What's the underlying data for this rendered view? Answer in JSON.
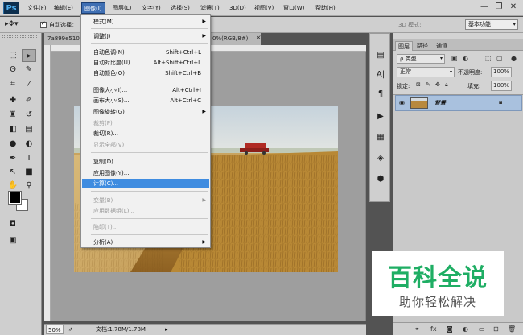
{
  "app": {
    "logo": "Ps"
  },
  "menubar": {
    "items": [
      "文件(F)",
      "编辑(E)",
      "图像(I)",
      "图层(L)",
      "文字(Y)",
      "选择(S)",
      "滤镜(T)",
      "3D(D)",
      "视图(V)",
      "窗口(W)",
      "帮助(H)"
    ],
    "active_index": 2
  },
  "window_controls": {
    "minimize": "—",
    "restore": "❐",
    "close": "✕"
  },
  "options_bar": {
    "tool_icon": "move-tool-icon",
    "auto_select_label": "自动选择：",
    "mode_3d_label": "3D 模式:",
    "workspace": "基本功能"
  },
  "document": {
    "tab_title": "7a899e510f",
    "tab_info": "0%(RGB/8#)",
    "tab_close": "×",
    "zoom": "50%",
    "doc_size": "文档:1.78M/1.78M"
  },
  "image_menu": {
    "items": [
      {
        "label": "模式(M)",
        "shortcut": "",
        "submenu": true,
        "disabled": false
      },
      {
        "label": "调整(J)",
        "shortcut": "",
        "submenu": true,
        "disabled": false
      },
      {
        "label": "自动色调(N)",
        "shortcut": "Shift+Ctrl+L",
        "submenu": false,
        "disabled": false
      },
      {
        "label": "自动对比度(U)",
        "shortcut": "Alt+Shift+Ctrl+L",
        "submenu": false,
        "disabled": false
      },
      {
        "label": "自动颜色(O)",
        "shortcut": "Shift+Ctrl+B",
        "submenu": false,
        "disabled": false
      },
      {
        "label": "图像大小(I)...",
        "shortcut": "Alt+Ctrl+I",
        "submenu": false,
        "disabled": false
      },
      {
        "label": "画布大小(S)...",
        "shortcut": "Alt+Ctrl+C",
        "submenu": false,
        "disabled": false
      },
      {
        "label": "图像旋转(G)",
        "shortcut": "",
        "submenu": true,
        "disabled": false
      },
      {
        "label": "裁剪(P)",
        "shortcut": "",
        "submenu": false,
        "disabled": true
      },
      {
        "label": "裁切(R)...",
        "shortcut": "",
        "submenu": false,
        "disabled": false
      },
      {
        "label": "显示全部(V)",
        "shortcut": "",
        "submenu": false,
        "disabled": true
      },
      {
        "label": "复制(D)...",
        "shortcut": "",
        "submenu": false,
        "disabled": false
      },
      {
        "label": "应用图像(Y)...",
        "shortcut": "",
        "submenu": false,
        "disabled": false
      },
      {
        "label": "计算(C)...",
        "shortcut": "",
        "submenu": false,
        "disabled": false,
        "highlighted": true
      },
      {
        "label": "变量(B)",
        "shortcut": "",
        "submenu": true,
        "disabled": true
      },
      {
        "label": "应用数据组(L)...",
        "shortcut": "",
        "submenu": false,
        "disabled": true
      },
      {
        "label": "陷印(T)...",
        "shortcut": "",
        "submenu": false,
        "disabled": true
      },
      {
        "label": "分析(A)",
        "shortcut": "",
        "submenu": true,
        "disabled": false
      }
    ]
  },
  "layers_panel": {
    "tabs": [
      "图层",
      "路径",
      "通道"
    ],
    "kind_filter": "ρ 类型",
    "blend_mode": "正常",
    "opacity_label": "不透明度:",
    "opacity_value": "100%",
    "lock_label": "锁定:",
    "fill_label": "填充:",
    "fill_value": "100%",
    "layer_name": "背景"
  },
  "watermark": {
    "title": "百科全说",
    "subtitle": "助你轻松解决"
  },
  "colors": {
    "menu_highlight": "#3f8ce0",
    "active_menu": "#3f6fb3",
    "layer_selected": "#a9c1de",
    "watermark_green": "#1fae64"
  }
}
